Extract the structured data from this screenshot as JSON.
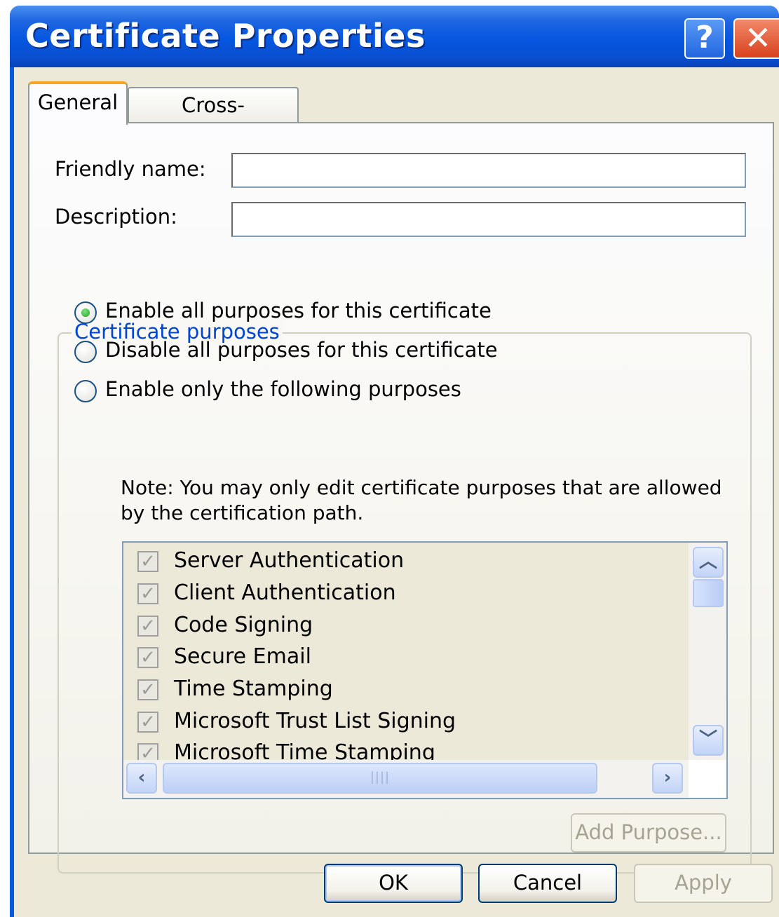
{
  "window": {
    "title": "Certificate Properties"
  },
  "titlebar": {
    "help_label": "?",
    "close_label": "✕"
  },
  "tabs": [
    {
      "label": "General",
      "active": true
    },
    {
      "label": "Cross-Certificates",
      "active": false
    }
  ],
  "fields": {
    "friendly_name": {
      "label": "Friendly name:",
      "value": ""
    },
    "description": {
      "label": "Description:",
      "value": ""
    }
  },
  "purposes": {
    "group_title": "Certificate purposes",
    "options": [
      {
        "label": "Enable all purposes for this certificate",
        "selected": true
      },
      {
        "label": "Disable all purposes for this certificate",
        "selected": false
      },
      {
        "label": "Enable only the following purposes",
        "selected": false
      }
    ],
    "note": "Note: You may only edit certificate purposes that are allowed by the certification path.",
    "items": [
      {
        "label": "Server Authentication",
        "checked": true
      },
      {
        "label": "Client Authentication",
        "checked": true
      },
      {
        "label": "Code Signing",
        "checked": true
      },
      {
        "label": "Secure Email",
        "checked": true
      },
      {
        "label": "Time Stamping",
        "checked": true
      },
      {
        "label": "Microsoft Trust List Signing",
        "checked": true
      },
      {
        "label": "Microsoft Time Stamping",
        "checked": true
      }
    ],
    "add_purpose_label": "Add Purpose..."
  },
  "buttons": {
    "ok": "OK",
    "cancel": "Cancel",
    "apply": "Apply"
  },
  "colors": {
    "titlebar": "#0a5ad8",
    "group_title": "#0046d5",
    "tab_accent": "#f5a623"
  }
}
